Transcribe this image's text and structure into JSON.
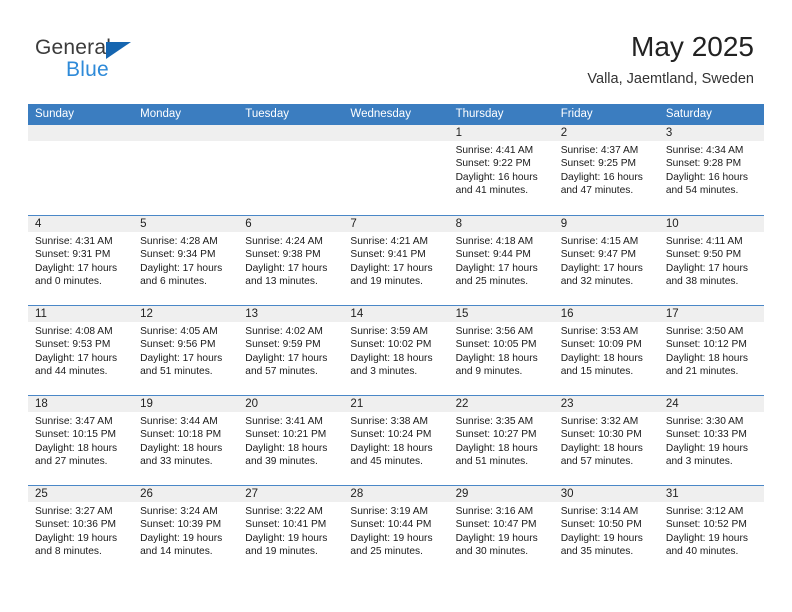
{
  "brand": {
    "name_part1": "General",
    "name_part2": "Blue",
    "accent_color": "#2e8ad8",
    "triangle_color": "#1565b0"
  },
  "header": {
    "title": "May 2025",
    "subtitle": "Valla, Jaemtland, Sweden"
  },
  "calendar": {
    "header_color": "#3b7dc0",
    "weekdays": [
      "Sunday",
      "Monday",
      "Tuesday",
      "Wednesday",
      "Thursday",
      "Friday",
      "Saturday"
    ],
    "weeks": [
      [
        {
          "day": "",
          "empty": true
        },
        {
          "day": "",
          "empty": true
        },
        {
          "day": "",
          "empty": true
        },
        {
          "day": "",
          "empty": true
        },
        {
          "day": "1",
          "sunrise": "Sunrise: 4:41 AM",
          "sunset": "Sunset: 9:22 PM",
          "daylight_l1": "Daylight: 16 hours",
          "daylight_l2": "and 41 minutes."
        },
        {
          "day": "2",
          "sunrise": "Sunrise: 4:37 AM",
          "sunset": "Sunset: 9:25 PM",
          "daylight_l1": "Daylight: 16 hours",
          "daylight_l2": "and 47 minutes."
        },
        {
          "day": "3",
          "sunrise": "Sunrise: 4:34 AM",
          "sunset": "Sunset: 9:28 PM",
          "daylight_l1": "Daylight: 16 hours",
          "daylight_l2": "and 54 minutes."
        }
      ],
      [
        {
          "day": "4",
          "sunrise": "Sunrise: 4:31 AM",
          "sunset": "Sunset: 9:31 PM",
          "daylight_l1": "Daylight: 17 hours",
          "daylight_l2": "and 0 minutes."
        },
        {
          "day": "5",
          "sunrise": "Sunrise: 4:28 AM",
          "sunset": "Sunset: 9:34 PM",
          "daylight_l1": "Daylight: 17 hours",
          "daylight_l2": "and 6 minutes."
        },
        {
          "day": "6",
          "sunrise": "Sunrise: 4:24 AM",
          "sunset": "Sunset: 9:38 PM",
          "daylight_l1": "Daylight: 17 hours",
          "daylight_l2": "and 13 minutes."
        },
        {
          "day": "7",
          "sunrise": "Sunrise: 4:21 AM",
          "sunset": "Sunset: 9:41 PM",
          "daylight_l1": "Daylight: 17 hours",
          "daylight_l2": "and 19 minutes."
        },
        {
          "day": "8",
          "sunrise": "Sunrise: 4:18 AM",
          "sunset": "Sunset: 9:44 PM",
          "daylight_l1": "Daylight: 17 hours",
          "daylight_l2": "and 25 minutes."
        },
        {
          "day": "9",
          "sunrise": "Sunrise: 4:15 AM",
          "sunset": "Sunset: 9:47 PM",
          "daylight_l1": "Daylight: 17 hours",
          "daylight_l2": "and 32 minutes."
        },
        {
          "day": "10",
          "sunrise": "Sunrise: 4:11 AM",
          "sunset": "Sunset: 9:50 PM",
          "daylight_l1": "Daylight: 17 hours",
          "daylight_l2": "and 38 minutes."
        }
      ],
      [
        {
          "day": "11",
          "sunrise": "Sunrise: 4:08 AM",
          "sunset": "Sunset: 9:53 PM",
          "daylight_l1": "Daylight: 17 hours",
          "daylight_l2": "and 44 minutes."
        },
        {
          "day": "12",
          "sunrise": "Sunrise: 4:05 AM",
          "sunset": "Sunset: 9:56 PM",
          "daylight_l1": "Daylight: 17 hours",
          "daylight_l2": "and 51 minutes."
        },
        {
          "day": "13",
          "sunrise": "Sunrise: 4:02 AM",
          "sunset": "Sunset: 9:59 PM",
          "daylight_l1": "Daylight: 17 hours",
          "daylight_l2": "and 57 minutes."
        },
        {
          "day": "14",
          "sunrise": "Sunrise: 3:59 AM",
          "sunset": "Sunset: 10:02 PM",
          "daylight_l1": "Daylight: 18 hours",
          "daylight_l2": "and 3 minutes."
        },
        {
          "day": "15",
          "sunrise": "Sunrise: 3:56 AM",
          "sunset": "Sunset: 10:05 PM",
          "daylight_l1": "Daylight: 18 hours",
          "daylight_l2": "and 9 minutes."
        },
        {
          "day": "16",
          "sunrise": "Sunrise: 3:53 AM",
          "sunset": "Sunset: 10:09 PM",
          "daylight_l1": "Daylight: 18 hours",
          "daylight_l2": "and 15 minutes."
        },
        {
          "day": "17",
          "sunrise": "Sunrise: 3:50 AM",
          "sunset": "Sunset: 10:12 PM",
          "daylight_l1": "Daylight: 18 hours",
          "daylight_l2": "and 21 minutes."
        }
      ],
      [
        {
          "day": "18",
          "sunrise": "Sunrise: 3:47 AM",
          "sunset": "Sunset: 10:15 PM",
          "daylight_l1": "Daylight: 18 hours",
          "daylight_l2": "and 27 minutes."
        },
        {
          "day": "19",
          "sunrise": "Sunrise: 3:44 AM",
          "sunset": "Sunset: 10:18 PM",
          "daylight_l1": "Daylight: 18 hours",
          "daylight_l2": "and 33 minutes."
        },
        {
          "day": "20",
          "sunrise": "Sunrise: 3:41 AM",
          "sunset": "Sunset: 10:21 PM",
          "daylight_l1": "Daylight: 18 hours",
          "daylight_l2": "and 39 minutes."
        },
        {
          "day": "21",
          "sunrise": "Sunrise: 3:38 AM",
          "sunset": "Sunset: 10:24 PM",
          "daylight_l1": "Daylight: 18 hours",
          "daylight_l2": "and 45 minutes."
        },
        {
          "day": "22",
          "sunrise": "Sunrise: 3:35 AM",
          "sunset": "Sunset: 10:27 PM",
          "daylight_l1": "Daylight: 18 hours",
          "daylight_l2": "and 51 minutes."
        },
        {
          "day": "23",
          "sunrise": "Sunrise: 3:32 AM",
          "sunset": "Sunset: 10:30 PM",
          "daylight_l1": "Daylight: 18 hours",
          "daylight_l2": "and 57 minutes."
        },
        {
          "day": "24",
          "sunrise": "Sunrise: 3:30 AM",
          "sunset": "Sunset: 10:33 PM",
          "daylight_l1": "Daylight: 19 hours",
          "daylight_l2": "and 3 minutes."
        }
      ],
      [
        {
          "day": "25",
          "sunrise": "Sunrise: 3:27 AM",
          "sunset": "Sunset: 10:36 PM",
          "daylight_l1": "Daylight: 19 hours",
          "daylight_l2": "and 8 minutes."
        },
        {
          "day": "26",
          "sunrise": "Sunrise: 3:24 AM",
          "sunset": "Sunset: 10:39 PM",
          "daylight_l1": "Daylight: 19 hours",
          "daylight_l2": "and 14 minutes."
        },
        {
          "day": "27",
          "sunrise": "Sunrise: 3:22 AM",
          "sunset": "Sunset: 10:41 PM",
          "daylight_l1": "Daylight: 19 hours",
          "daylight_l2": "and 19 minutes."
        },
        {
          "day": "28",
          "sunrise": "Sunrise: 3:19 AM",
          "sunset": "Sunset: 10:44 PM",
          "daylight_l1": "Daylight: 19 hours",
          "daylight_l2": "and 25 minutes."
        },
        {
          "day": "29",
          "sunrise": "Sunrise: 3:16 AM",
          "sunset": "Sunset: 10:47 PM",
          "daylight_l1": "Daylight: 19 hours",
          "daylight_l2": "and 30 minutes."
        },
        {
          "day": "30",
          "sunrise": "Sunrise: 3:14 AM",
          "sunset": "Sunset: 10:50 PM",
          "daylight_l1": "Daylight: 19 hours",
          "daylight_l2": "and 35 minutes."
        },
        {
          "day": "31",
          "sunrise": "Sunrise: 3:12 AM",
          "sunset": "Sunset: 10:52 PM",
          "daylight_l1": "Daylight: 19 hours",
          "daylight_l2": "and 40 minutes."
        }
      ]
    ]
  }
}
